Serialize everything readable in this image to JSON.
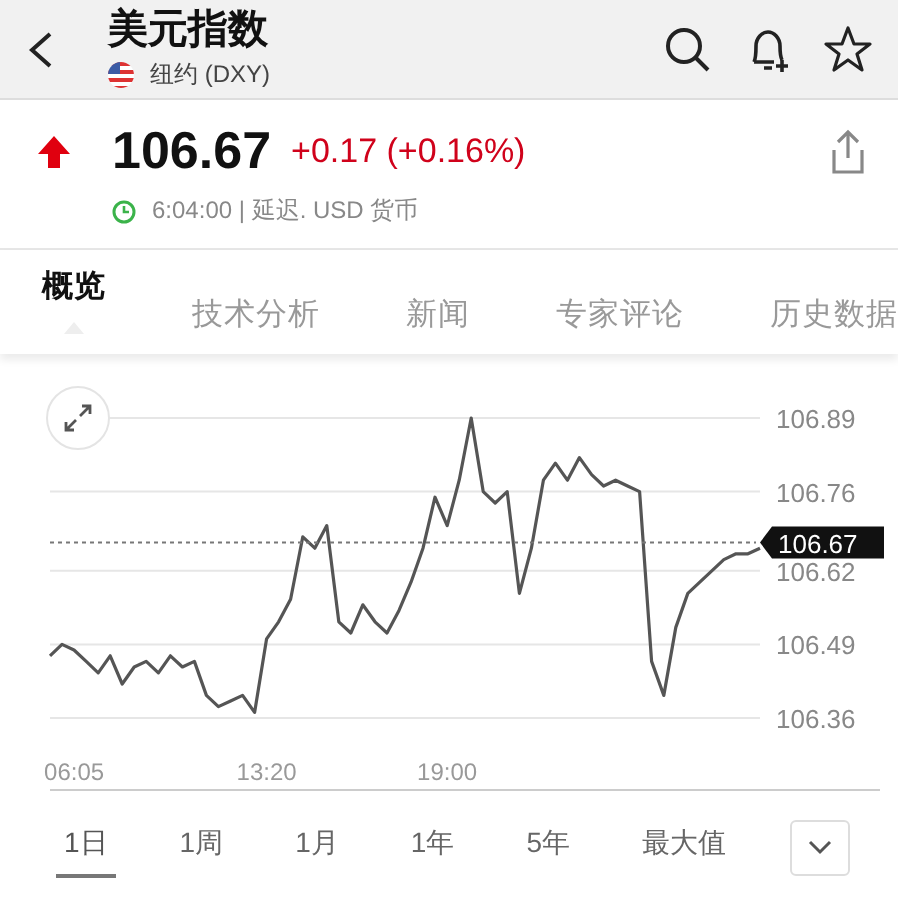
{
  "header": {
    "title": "美元指数",
    "subtitle": "纽约 (DXY)"
  },
  "quote": {
    "price": "106.67",
    "change": "+0.17 (+0.16%)",
    "time": "6:04:00",
    "status": "| 延迟. USD 货币"
  },
  "tabs": [
    {
      "label": "概览",
      "selected": true
    },
    {
      "label": "技术分析",
      "selected": false
    },
    {
      "label": "新闻",
      "selected": false
    },
    {
      "label": "专家评论",
      "selected": false
    },
    {
      "label": "历史数据",
      "selected": false
    }
  ],
  "chart": {
    "chart_data": {
      "type": "line",
      "grid": true,
      "categories": [
        null,
        null,
        "06:05",
        null,
        null,
        null,
        null,
        null,
        null,
        null,
        null,
        null,
        null,
        null,
        null,
        null,
        null,
        null,
        "13:20",
        null,
        null,
        null,
        null,
        null,
        null,
        null,
        null,
        null,
        null,
        null,
        null,
        null,
        null,
        "19:00",
        null,
        null,
        null,
        null,
        null,
        null,
        null,
        null,
        null,
        null,
        null,
        null,
        null,
        null,
        null,
        null,
        null,
        null,
        null,
        null,
        null,
        null,
        null,
        null,
        null,
        null
      ],
      "series": [
        {
          "color": "#555555",
          "values": [
            106.47,
            106.49,
            106.48,
            106.46,
            106.44,
            106.47,
            106.42,
            106.45,
            106.46,
            106.44,
            106.47,
            106.45,
            106.46,
            106.4,
            106.38,
            106.39,
            106.4,
            106.37,
            106.5,
            106.53,
            106.57,
            106.68,
            106.66,
            106.7,
            106.53,
            106.51,
            106.56,
            106.53,
            106.51,
            106.55,
            106.6,
            106.66,
            106.75,
            106.7,
            106.78,
            106.89,
            106.76,
            106.74,
            106.76,
            106.58,
            106.66,
            106.78,
            106.81,
            106.78,
            106.82,
            106.79,
            106.77,
            106.78,
            106.77,
            106.76,
            106.46,
            106.4,
            106.52,
            106.58,
            106.6,
            106.62,
            106.64,
            106.65,
            106.65,
            106.66
          ]
        }
      ],
      "ylim": [
        106.36,
        106.89
      ],
      "yticks": [
        106.89,
        106.76,
        106.62,
        106.49,
        106.36
      ],
      "ref_lines": [
        {
          "axis": "y",
          "value": 106.67,
          "label": "106.67"
        }
      ]
    }
  },
  "ranges": [
    {
      "label": "1日",
      "selected": true
    },
    {
      "label": "1周",
      "selected": false
    },
    {
      "label": "1月",
      "selected": false
    },
    {
      "label": "1年",
      "selected": false
    },
    {
      "label": "5年",
      "selected": false
    },
    {
      "label": "最大值",
      "selected": false
    }
  ]
}
